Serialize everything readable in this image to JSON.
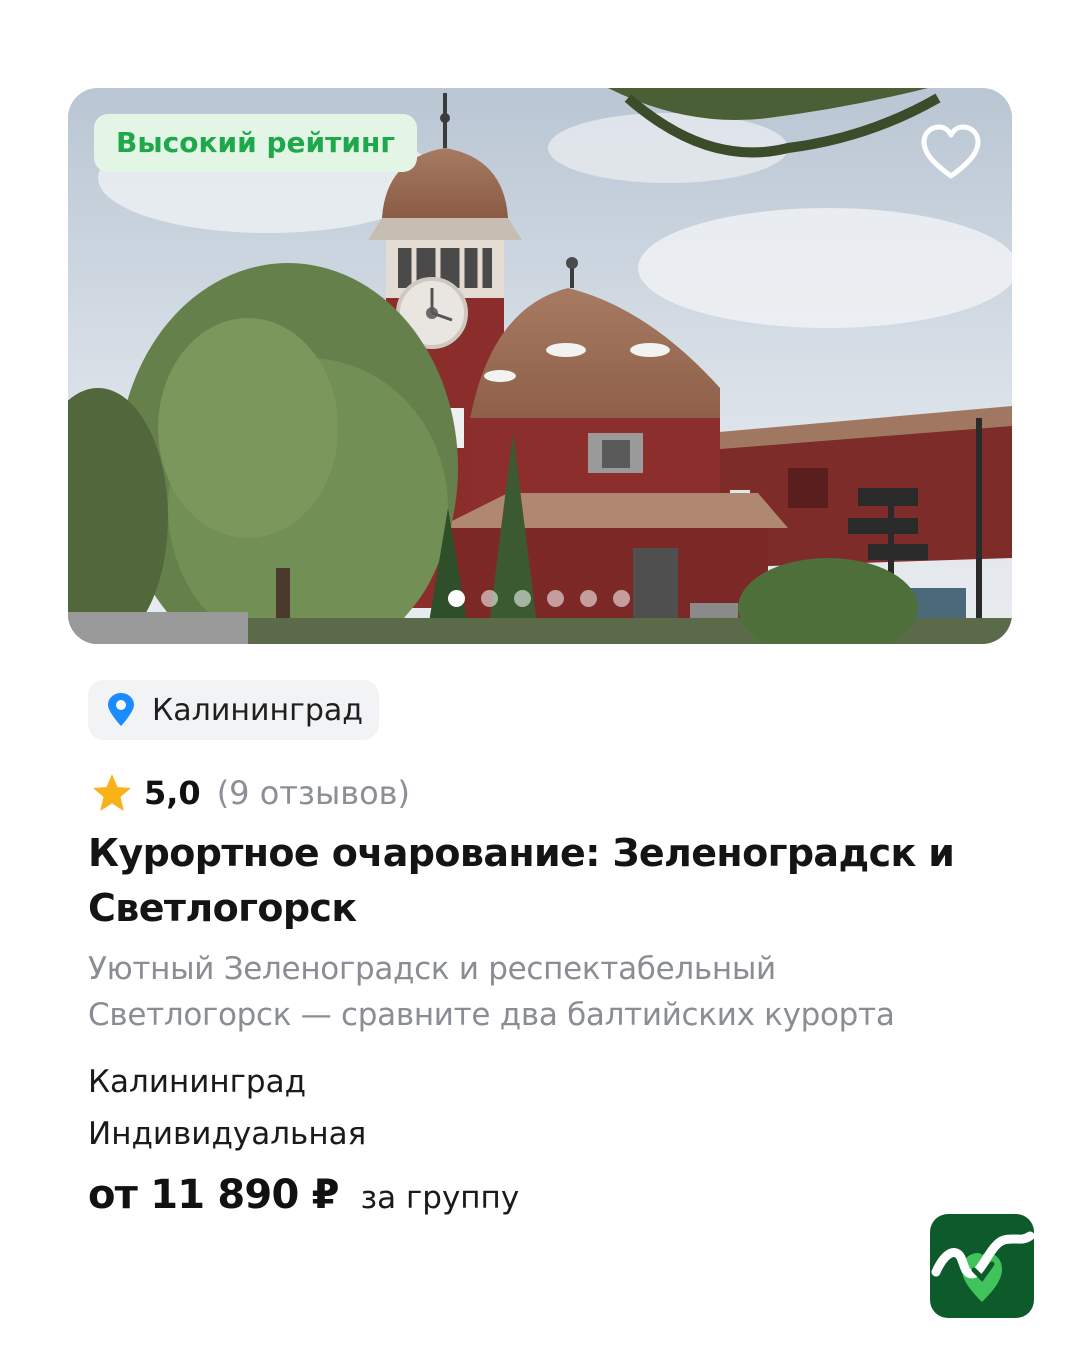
{
  "card": {
    "badge": "Высокий рейтинг",
    "favorite_icon": "heart-outline-icon",
    "photo_dots": {
      "count": 6,
      "active_index": 0
    }
  },
  "location_chip": {
    "icon": "map-pin-icon",
    "label": "Калининград",
    "icon_color": "#1a8cff"
  },
  "rating": {
    "icon": "star-icon",
    "value": "5,0",
    "count": "(9 отзывов)",
    "star_color": "#f9b21a"
  },
  "tour": {
    "title": "Курортное очарование: Зеленоградск и Светлогорск",
    "description": "Уютный Зеленоградск и респектабельный Светлогорск — сравните два балтийских курорта",
    "city": "Калининград",
    "type": "Индивидуальная",
    "price": "от 11 890 ₽",
    "price_unit": "за группу"
  },
  "brand": {
    "logo_icon": "brand-logo-icon",
    "color": "#0d5a2a"
  },
  "colors": {
    "badge_text": "#1ea84b",
    "badge_bg": "#e3f6e6",
    "muted_text": "#8a8d94"
  }
}
